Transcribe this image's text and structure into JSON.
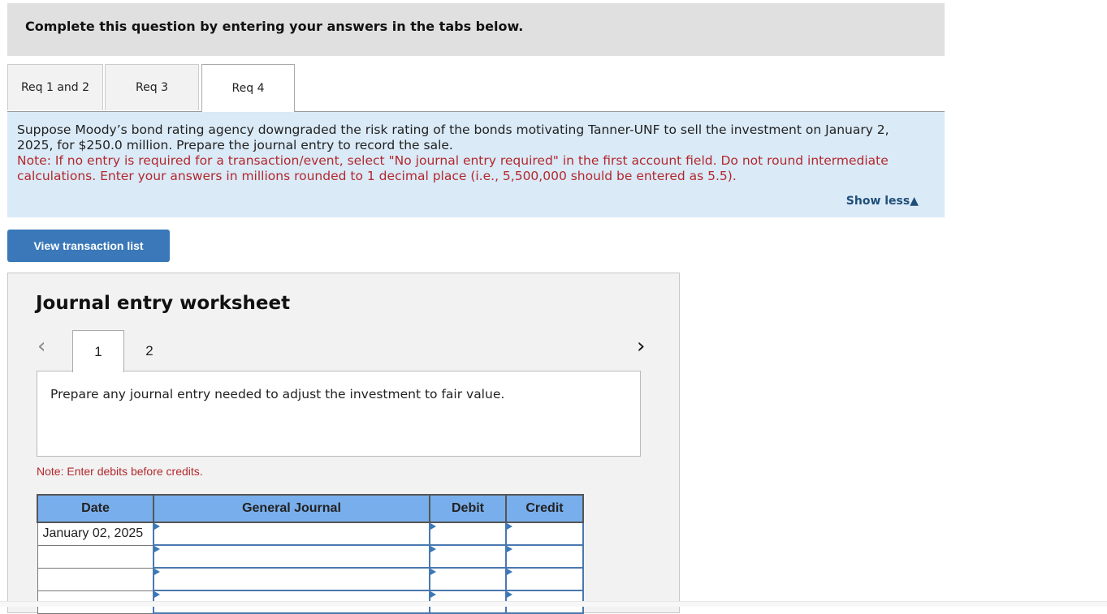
{
  "header": {
    "instruction": "Complete this question by entering your answers in the tabs below."
  },
  "tabs": [
    {
      "label": "Req 1 and 2",
      "active": false
    },
    {
      "label": "Req 3",
      "active": false
    },
    {
      "label": "Req 4",
      "active": true
    }
  ],
  "question": {
    "text": "Suppose Moody’s bond rating agency downgraded the risk rating of the bonds motivating Tanner-UNF to sell the investment on January 2, 2025, for $250.0 million. Prepare the journal entry to record the sale.",
    "note": "Note: If no entry is required for a transaction/event, select \"No journal entry required\" in the first account field. Do not round intermediate calculations. Enter your answers in millions rounded to 1 decimal place (i.e., 5,500,000 should be entered as 5.5).",
    "show_less": "Show less",
    "show_less_icon": "▲"
  },
  "view_transaction_button": "View transaction list",
  "worksheet": {
    "title": "Journal entry worksheet",
    "prev_icon": "‹",
    "next_icon": "›",
    "pages": [
      {
        "label": "1",
        "active": true
      },
      {
        "label": "2",
        "active": false
      }
    ],
    "instruction": "Prepare any journal entry needed to adjust the investment to fair value.",
    "note": "Note: Enter debits before credits.",
    "table": {
      "headers": [
        "Date",
        "General Journal",
        "Debit",
        "Credit"
      ],
      "rows": [
        {
          "date": "January 02, 2025",
          "account": "",
          "debit": "",
          "credit": ""
        },
        {
          "date": "",
          "account": "",
          "debit": "",
          "credit": ""
        },
        {
          "date": "",
          "account": "",
          "debit": "",
          "credit": ""
        },
        {
          "date": "",
          "account": "",
          "debit": "",
          "credit": ""
        }
      ]
    }
  }
}
